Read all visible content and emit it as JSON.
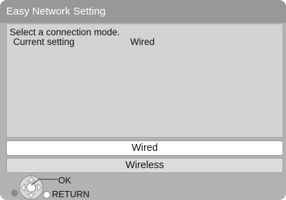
{
  "title": "Easy Network Setting",
  "prompt": "Select a connection mode.",
  "current_setting": {
    "label": "Current setting",
    "value": "Wired"
  },
  "options": [
    {
      "label": "Wired",
      "selected": true
    },
    {
      "label": "Wireless",
      "selected": false
    }
  ],
  "controls": {
    "ok_label": "OK",
    "return_label": "RETURN"
  },
  "colors": {
    "frame": "#b3b3b3",
    "title_bar": "#989898",
    "panel": "#d3d3d3",
    "selected_option": "#ffffff",
    "option": "#dcdcdc"
  },
  "icons": [
    "dpad-icon",
    "return-dot-icon",
    "function-dot-icon"
  ]
}
